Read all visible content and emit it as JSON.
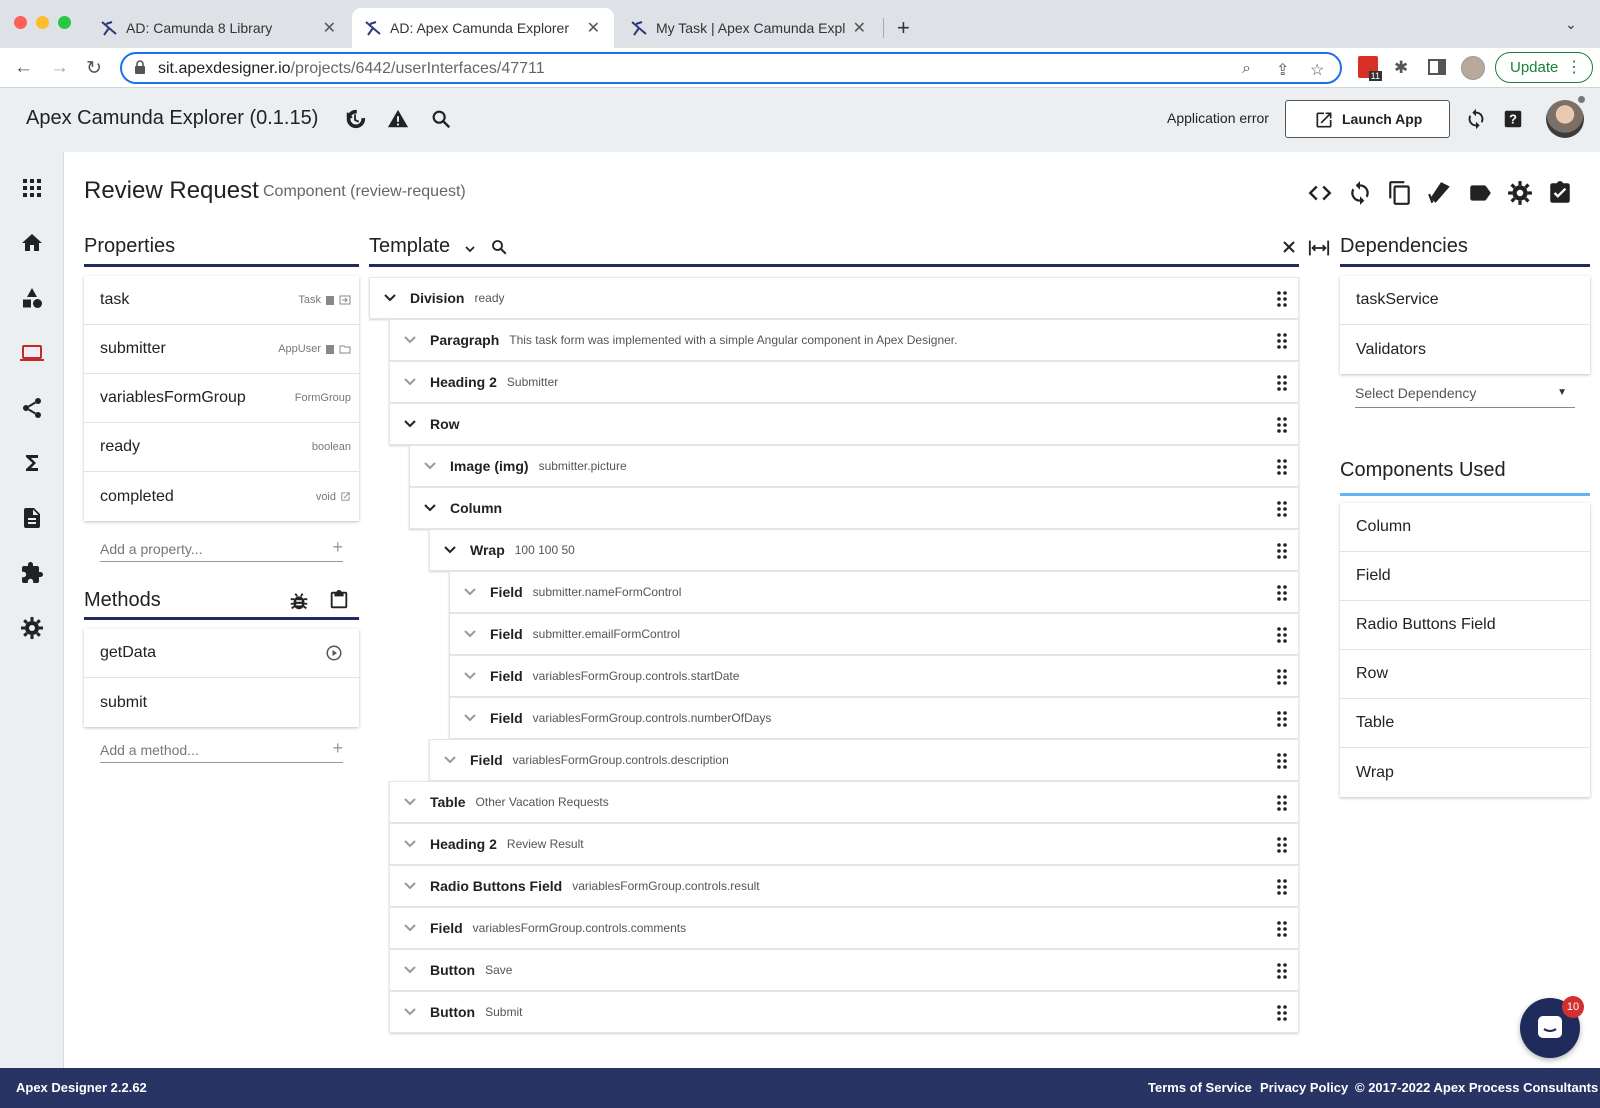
{
  "browser": {
    "tabs": [
      {
        "title": "AD: Camunda 8 Library"
      },
      {
        "title": "AD: Apex Camunda Explorer"
      },
      {
        "title": "My Task | Apex Camunda Explorer"
      }
    ],
    "new_tab": "+",
    "url_host": "sit.apexdesigner.io",
    "url_path": "/projects/6442/userInterfaces/47711",
    "calendar_badge": "11",
    "update_label": "Update"
  },
  "header": {
    "app_title": "Apex Camunda Explorer (0.1.15)",
    "app_error": "Application error",
    "launch_label": "Launch App"
  },
  "page": {
    "title": "Review Request",
    "subtitle": "Component (review-request)"
  },
  "properties": {
    "title": "Properties",
    "items": [
      {
        "name": "task",
        "type": "Task"
      },
      {
        "name": "submitter",
        "type": "AppUser"
      },
      {
        "name": "variablesFormGroup",
        "type": "FormGroup"
      },
      {
        "name": "ready",
        "type": "boolean"
      },
      {
        "name": "completed",
        "type": "void"
      }
    ],
    "add_placeholder": "Add a property..."
  },
  "methods": {
    "title": "Methods",
    "items": [
      {
        "name": "getData"
      },
      {
        "name": "submit"
      }
    ],
    "add_placeholder": "Add a method..."
  },
  "template": {
    "title": "Template",
    "nodes": [
      {
        "name": "Division",
        "desc": "ready",
        "depth": 0,
        "expanded": true
      },
      {
        "name": "Paragraph",
        "desc": "This task form was implemented with a simple Angular component in Apex Designer.",
        "depth": 1,
        "expanded": false
      },
      {
        "name": "Heading 2",
        "desc": "Submitter",
        "depth": 1,
        "expanded": false
      },
      {
        "name": "Row",
        "desc": "",
        "depth": 1,
        "expanded": true
      },
      {
        "name": "Image (img)",
        "desc": "submitter.picture",
        "depth": 2,
        "expanded": false
      },
      {
        "name": "Column",
        "desc": "",
        "depth": 2,
        "expanded": true
      },
      {
        "name": "Wrap",
        "desc": "100 100 50",
        "depth": 3,
        "expanded": true
      },
      {
        "name": "Field",
        "desc": "submitter.nameFormControl",
        "depth": 4,
        "expanded": false
      },
      {
        "name": "Field",
        "desc": "submitter.emailFormControl",
        "depth": 4,
        "expanded": false
      },
      {
        "name": "Field",
        "desc": "variablesFormGroup.controls.startDate",
        "depth": 4,
        "expanded": false
      },
      {
        "name": "Field",
        "desc": "variablesFormGroup.controls.numberOfDays",
        "depth": 4,
        "expanded": false
      },
      {
        "name": "Field",
        "desc": "variablesFormGroup.controls.description",
        "depth": 3,
        "expanded": false
      },
      {
        "name": "Table",
        "desc": "Other Vacation Requests",
        "depth": 1,
        "expanded": false
      },
      {
        "name": "Heading 2",
        "desc": "Review Result",
        "depth": 1,
        "expanded": false
      },
      {
        "name": "Radio Buttons Field",
        "desc": "variablesFormGroup.controls.result",
        "depth": 1,
        "expanded": false
      },
      {
        "name": "Field",
        "desc": "variablesFormGroup.controls.comments",
        "depth": 1,
        "expanded": false
      },
      {
        "name": "Button",
        "desc": "Save",
        "depth": 1,
        "expanded": false
      },
      {
        "name": "Button",
        "desc": "Submit",
        "depth": 1,
        "expanded": false
      }
    ]
  },
  "dependencies": {
    "title": "Dependencies",
    "items": [
      {
        "name": "taskService"
      },
      {
        "name": "Validators"
      }
    ],
    "select_placeholder": "Select Dependency"
  },
  "components_used": {
    "title": "Components Used",
    "items": [
      {
        "name": "Column"
      },
      {
        "name": "Field"
      },
      {
        "name": "Radio Buttons Field"
      },
      {
        "name": "Row"
      },
      {
        "name": "Table"
      },
      {
        "name": "Wrap"
      }
    ]
  },
  "chat": {
    "badge": "10"
  },
  "footer": {
    "version": "Apex Designer 2.2.62",
    "terms": "Terms of Service",
    "privacy": "Privacy Policy",
    "copyright": "© 2017-2022 Apex Process Consultants"
  },
  "colors": {
    "accent": "#1f2b5b",
    "footer": "#283464",
    "chrome": "#dee1e6",
    "header": "#eceff1"
  }
}
